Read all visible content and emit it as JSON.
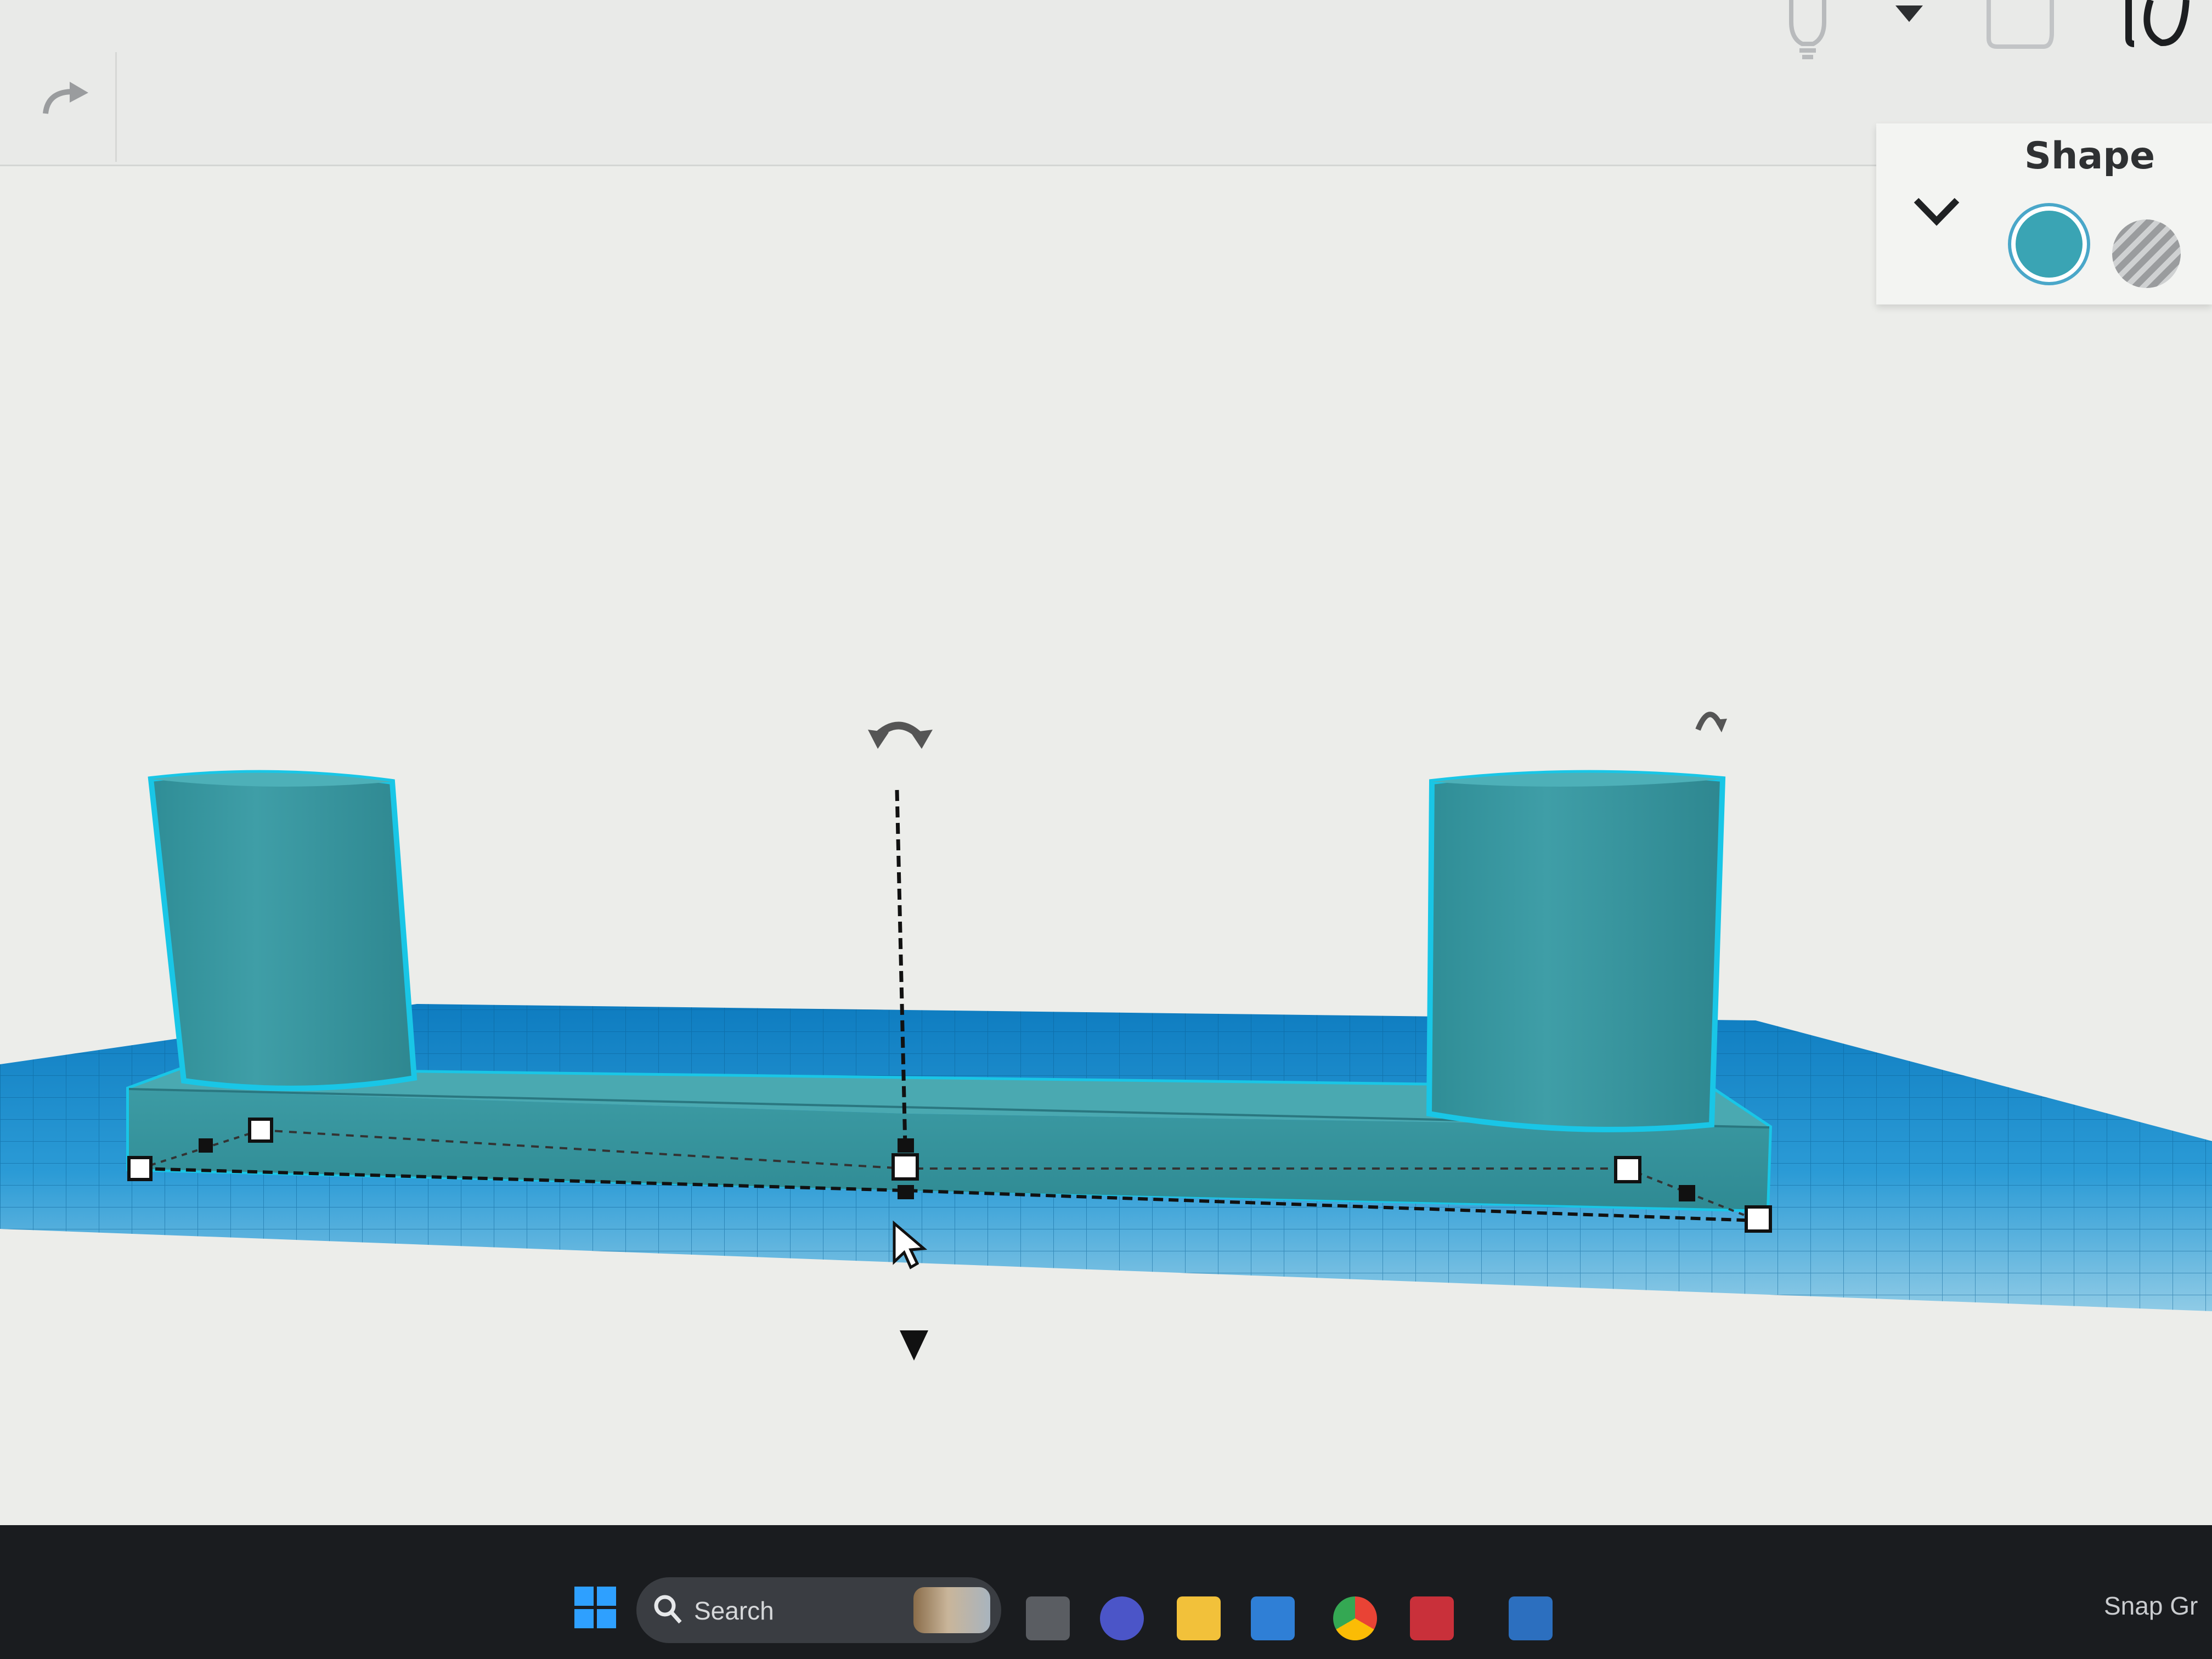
{
  "panel": {
    "title": "Shape",
    "solid_color": "#3aa4b4",
    "swatches": [
      {
        "name": "solid",
        "color": "#3aa4b4",
        "selected": true
      },
      {
        "name": "hole",
        "color": "#a6a8aa",
        "selected": false
      }
    ]
  },
  "toolbar": {
    "icons": [
      "redo-icon",
      "lightbulb-icon",
      "dropdown-arrow-icon",
      "speech-bubble-icon",
      "rotate-view-icon"
    ]
  },
  "scene": {
    "workplane_color": "#1f8fcc",
    "object_color": "#3a9ca6",
    "selection_outline": "#19c6e6"
  },
  "taskbar": {
    "search_placeholder": "Search",
    "snap_grid_label": "Snap Gr",
    "apps": [
      "task-view-icon",
      "video-call-icon",
      "file-explorer-icon",
      "store-icon",
      "chrome-icon",
      "app-icon",
      "monitor-app-icon"
    ]
  }
}
